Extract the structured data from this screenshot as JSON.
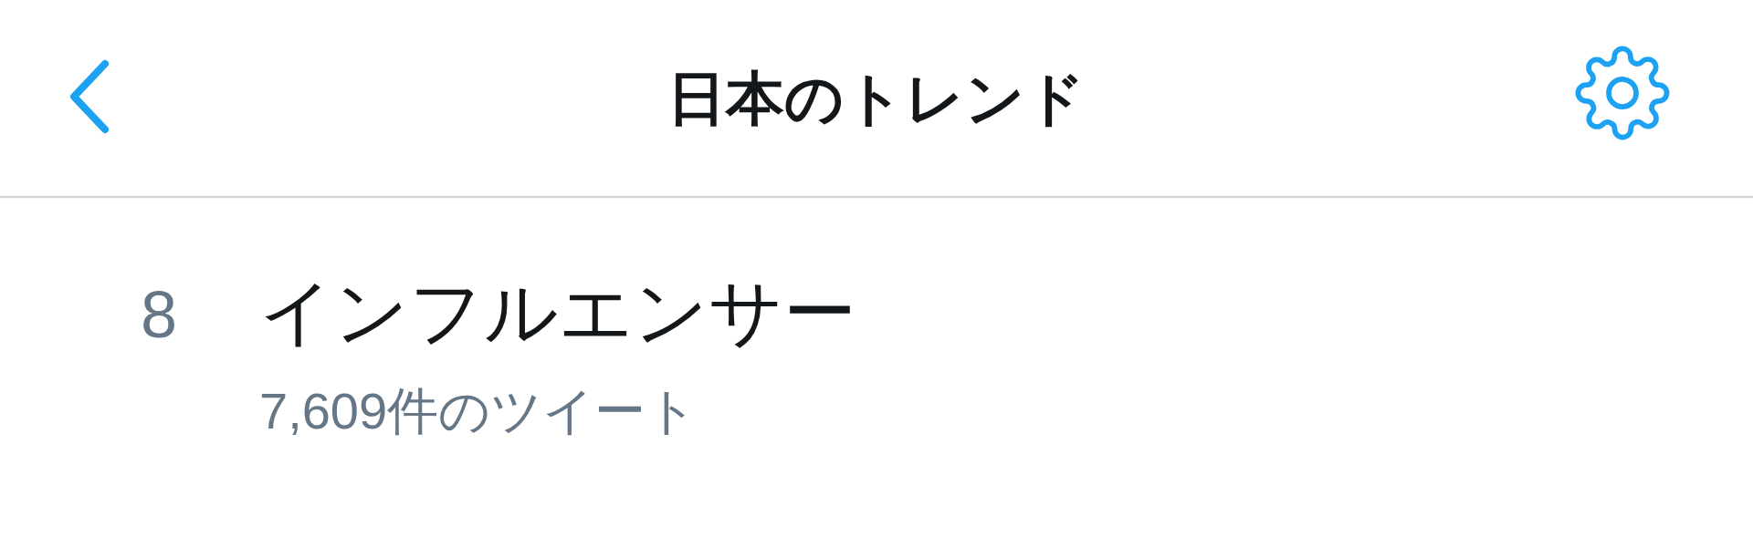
{
  "header": {
    "title": "日本のトレンド"
  },
  "trends": [
    {
      "rank": "8",
      "name": "インフルエンサー",
      "count": "7,609件のツイート"
    }
  ]
}
